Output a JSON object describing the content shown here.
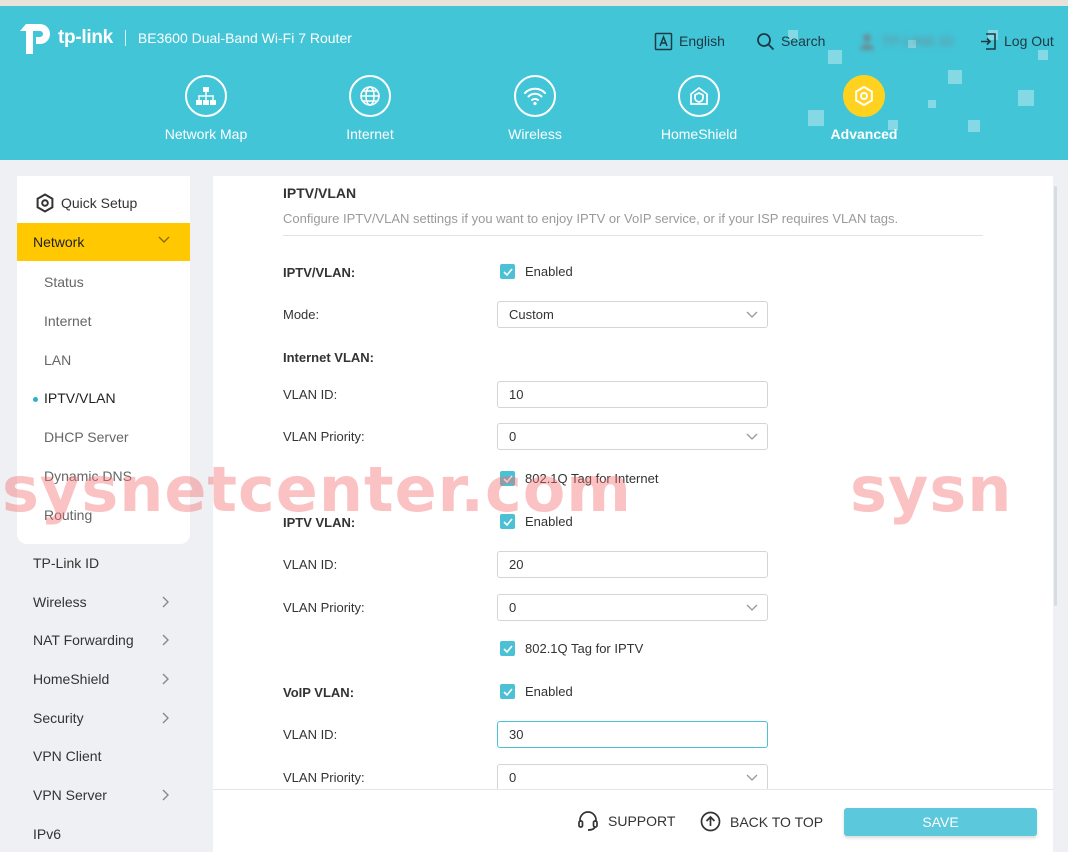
{
  "header": {
    "brand": "tp-link",
    "model": "BE3600 Dual-Band Wi-Fi 7 Router",
    "language_label": "English",
    "search_label": "Search",
    "account_label": "TP-LINK ID",
    "logout_label": "Log Out",
    "nav": [
      {
        "label": "Network Map",
        "icon": "network-map-icon"
      },
      {
        "label": "Internet",
        "icon": "globe-icon"
      },
      {
        "label": "Wireless",
        "icon": "wifi-icon"
      },
      {
        "label": "HomeShield",
        "icon": "homeshield-icon"
      },
      {
        "label": "Advanced",
        "icon": "gear-icon",
        "active": true
      }
    ]
  },
  "sidebar": {
    "quick_setup": "Quick Setup",
    "network": {
      "label": "Network",
      "items": [
        "Status",
        "Internet",
        "LAN",
        "IPTV/VLAN",
        "DHCP Server",
        "Dynamic DNS",
        "Routing"
      ],
      "active": "IPTV/VLAN"
    },
    "menu": [
      "TP-Link ID",
      "Wireless",
      "NAT Forwarding",
      "HomeShield",
      "Security",
      "VPN Client",
      "VPN Server",
      "IPv6"
    ]
  },
  "content": {
    "title": "IPTV/VLAN",
    "description": "Configure IPTV/VLAN settings if you want to enjoy IPTV or VoIP service, or if your ISP requires VLAN tags.",
    "iptv_vlan": {
      "label": "IPTV/VLAN:",
      "checkbox": "Enabled",
      "checked": true
    },
    "mode": {
      "label": "Mode:",
      "value": "Custom"
    },
    "internet_vlan": {
      "heading": "Internet VLAN:",
      "vlan_id_label": "VLAN ID:",
      "vlan_id": "10",
      "priority_label": "VLAN Priority:",
      "priority": "0",
      "tag_label": "802.1Q Tag for Internet",
      "tag_checked": true
    },
    "iptv_vlan_section": {
      "heading": "IPTV VLAN:",
      "enabled_label": "Enabled",
      "vlan_id_label": "VLAN ID:",
      "vlan_id": "20",
      "priority_label": "VLAN Priority:",
      "priority": "0",
      "tag_label": "802.1Q Tag for IPTV",
      "tag_checked": true
    },
    "voip_vlan": {
      "heading": "VoIP VLAN:",
      "enabled_label": "Enabled",
      "vlan_id_label": "VLAN ID:",
      "vlan_id": "30",
      "priority_label": "VLAN Priority:",
      "priority": "0"
    }
  },
  "footer": {
    "support": "SUPPORT",
    "back_to_top": "BACK TO TOP",
    "save": "SAVE"
  },
  "watermark": {
    "text1": "sysnetcenter.com",
    "text2": "sysn"
  },
  "colors": {
    "header": "#43c5d8",
    "accent": "#4cc0d4",
    "active_menu": "#ffc800",
    "advanced_icon": "#ffd21f"
  }
}
